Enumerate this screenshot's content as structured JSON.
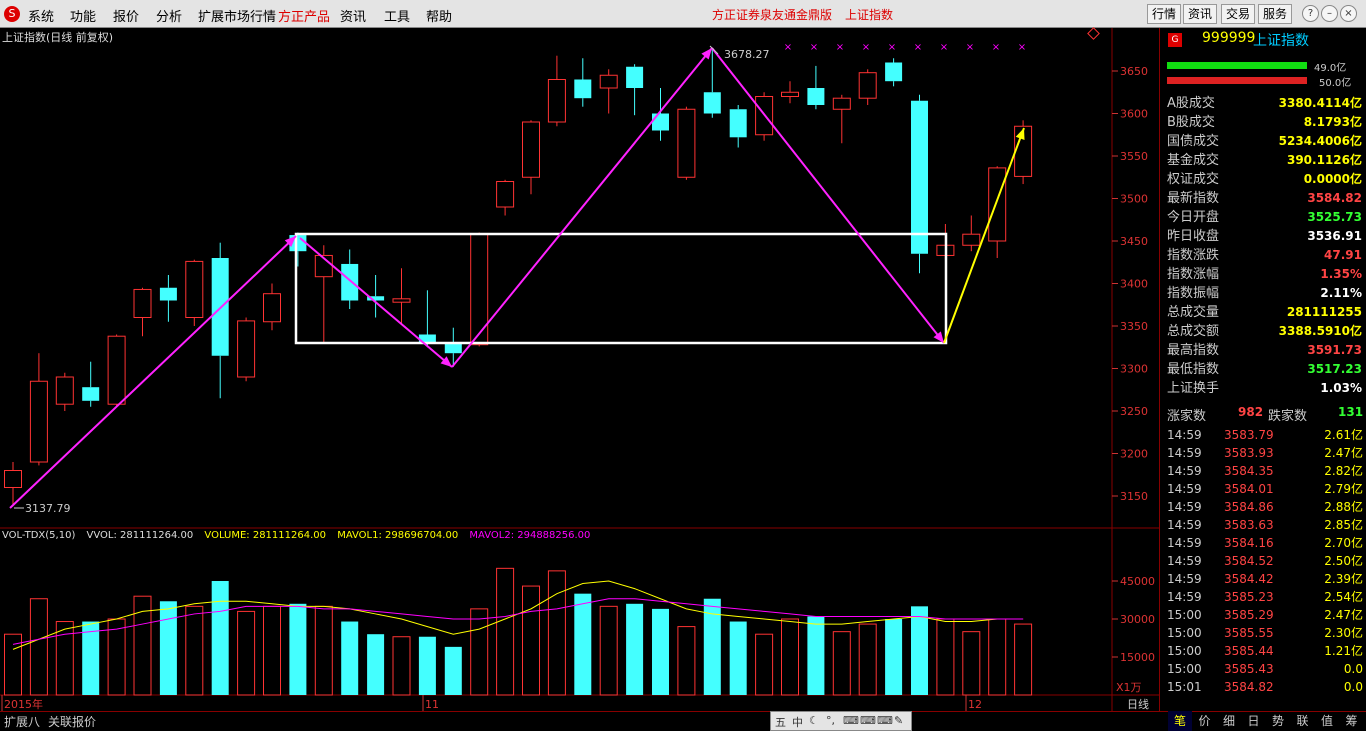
{
  "menu": {
    "items": [
      "系统",
      "功能",
      "报价",
      "分析",
      "扩展市场行情",
      "方正产品",
      "资讯",
      "工具",
      "帮助"
    ],
    "title": "方正证券泉友通金鼎版",
    "title2": "上证指数",
    "right_buttons": [
      "行情",
      "资讯",
      "交易",
      "服务"
    ]
  },
  "chart": {
    "title": "上证指数(日线 前复权)",
    "high_label": "3678.27",
    "low_label": "3137.79",
    "price_ticks": [
      "3650",
      "3600",
      "3550",
      "3500",
      "3450",
      "3400",
      "3350",
      "3300",
      "3250",
      "3200",
      "3150"
    ],
    "vol_ticks": [
      "45000",
      "30000",
      "15000"
    ],
    "vol_unit": "X1万",
    "date_labels": [
      "2015年",
      "11",
      "12"
    ],
    "vol_header": {
      "name": "VOL-TDX(5,10)",
      "vvol": "VVOL: 281111264.00",
      "volume": "VOLUME: 281111264.00",
      "mavol1": "MAVOL1: 298696704.00",
      "mavol2": "MAVOL2: 294888256.00"
    }
  },
  "chart_data": {
    "type": "candlestick",
    "candles": [
      {
        "o": 3160,
        "c": 3180,
        "h": 3190,
        "l": 3138,
        "up": true
      },
      {
        "o": 3190,
        "c": 3285,
        "h": 3318,
        "l": 3186,
        "up": true
      },
      {
        "o": 3258,
        "c": 3290,
        "h": 3295,
        "l": 3250,
        "up": true
      },
      {
        "o": 3278,
        "c": 3262,
        "h": 3308,
        "l": 3255,
        "up": false
      },
      {
        "o": 3258,
        "c": 3338,
        "h": 3340,
        "l": 3255,
        "up": true
      },
      {
        "o": 3360,
        "c": 3393,
        "h": 3395,
        "l": 3338,
        "up": true
      },
      {
        "o": 3395,
        "c": 3380,
        "h": 3410,
        "l": 3355,
        "up": false
      },
      {
        "o": 3360,
        "c": 3426,
        "h": 3428,
        "l": 3350,
        "up": true
      },
      {
        "o": 3430,
        "c": 3315,
        "h": 3448,
        "l": 3265,
        "up": false
      },
      {
        "o": 3290,
        "c": 3356,
        "h": 3360,
        "l": 3285,
        "up": true
      },
      {
        "o": 3355,
        "c": 3388,
        "h": 3400,
        "l": 3345,
        "up": true
      },
      {
        "o": 3457,
        "c": 3438,
        "h": 3460,
        "l": 3420,
        "up": false
      },
      {
        "o": 3408,
        "c": 3433,
        "h": 3445,
        "l": 3330,
        "up": true
      },
      {
        "o": 3423,
        "c": 3380,
        "h": 3440,
        "l": 3370,
        "up": false
      },
      {
        "o": 3385,
        "c": 3380,
        "h": 3410,
        "l": 3360,
        "up": false
      },
      {
        "o": 3378,
        "c": 3382,
        "h": 3418,
        "l": 3352,
        "up": true
      },
      {
        "o": 3340,
        "c": 3330,
        "h": 3392,
        "l": 3325,
        "up": false
      },
      {
        "o": 3330,
        "c": 3318,
        "h": 3348,
        "l": 3302,
        "up": false
      },
      {
        "o": 3328,
        "c": 3458,
        "h": 3460,
        "l": 3326,
        "up": true
      },
      {
        "o": 3490,
        "c": 3520,
        "h": 3522,
        "l": 3480,
        "up": true
      },
      {
        "o": 3525,
        "c": 3590,
        "h": 3592,
        "l": 3505,
        "up": true
      },
      {
        "o": 3590,
        "c": 3640,
        "h": 3668,
        "l": 3585,
        "up": true
      },
      {
        "o": 3640,
        "c": 3618,
        "h": 3665,
        "l": 3608,
        "up": false
      },
      {
        "o": 3630,
        "c": 3645,
        "h": 3652,
        "l": 3600,
        "up": true
      },
      {
        "o": 3655,
        "c": 3630,
        "h": 3658,
        "l": 3598,
        "up": false
      },
      {
        "o": 3600,
        "c": 3580,
        "h": 3630,
        "l": 3568,
        "up": false
      },
      {
        "o": 3525,
        "c": 3605,
        "h": 3608,
        "l": 3522,
        "up": true
      },
      {
        "o": 3625,
        "c": 3600,
        "h": 3675,
        "l": 3595,
        "up": false
      },
      {
        "o": 3605,
        "c": 3572,
        "h": 3610,
        "l": 3560,
        "up": false
      },
      {
        "o": 3575,
        "c": 3620,
        "h": 3625,
        "l": 3568,
        "up": true
      },
      {
        "o": 3620,
        "c": 3625,
        "h": 3638,
        "l": 3612,
        "up": true
      },
      {
        "o": 3630,
        "c": 3610,
        "h": 3656,
        "l": 3605,
        "up": false
      },
      {
        "o": 3605,
        "c": 3618,
        "h": 3622,
        "l": 3565,
        "up": true
      },
      {
        "o": 3618,
        "c": 3648,
        "h": 3652,
        "l": 3610,
        "up": true
      },
      {
        "o": 3660,
        "c": 3638,
        "h": 3665,
        "l": 3632,
        "up": false
      },
      {
        "o": 3615,
        "c": 3435,
        "h": 3622,
        "l": 3412,
        "up": false
      },
      {
        "o": 3445,
        "c": 3433,
        "h": 3470,
        "l": 3428,
        "up": true
      },
      {
        "o": 3445,
        "c": 3458,
        "h": 3480,
        "l": 3438,
        "up": true
      },
      {
        "o": 3450,
        "c": 3536,
        "h": 3538,
        "l": 3430,
        "up": true
      },
      {
        "o": 3526,
        "c": 3585,
        "h": 3592,
        "l": 3517,
        "up": true
      }
    ],
    "volumes": [
      24000,
      38000,
      29000,
      29000,
      30000,
      39000,
      37000,
      35000,
      45000,
      33000,
      35000,
      36000,
      35000,
      29000,
      24000,
      23000,
      23000,
      19000,
      34000,
      50000,
      43000,
      49000,
      40000,
      35000,
      36000,
      34000,
      27000,
      38000,
      29000,
      24000,
      30000,
      31000,
      25000,
      28000,
      30000,
      35000,
      30000,
      25000,
      30000,
      28000
    ],
    "mavol1": [
      18000,
      22000,
      26000,
      28000,
      30000,
      33000,
      34000,
      36000,
      37000,
      37000,
      36000,
      35000,
      35000,
      34000,
      32000,
      30000,
      27000,
      24000,
      26000,
      30000,
      34000,
      40000,
      44000,
      45000,
      42000,
      38000,
      34000,
      32000,
      31000,
      30000,
      29000,
      28000,
      28000,
      29000,
      30000,
      31000,
      29000,
      29000,
      30000,
      30000
    ],
    "mavol2": [
      20000,
      22000,
      24000,
      25000,
      26000,
      28000,
      30000,
      32000,
      33000,
      35000,
      35000,
      35000,
      34000,
      34000,
      33000,
      32000,
      31000,
      30000,
      30000,
      31000,
      33000,
      34000,
      36000,
      38000,
      38000,
      37000,
      36000,
      35000,
      34000,
      33000,
      32000,
      31000,
      31000,
      31000,
      31000,
      31000,
      30000,
      30000,
      30000,
      30000
    ],
    "price_range": [
      3110,
      3720
    ],
    "vol_range": [
      0,
      60000
    ]
  },
  "panel": {
    "code": "999999",
    "name": "上证指数",
    "buy_amount": "49.0亿",
    "sell_amount": "50.0亿",
    "rows": [
      {
        "label": "A股成交",
        "value": "3380.4114亿",
        "color": "#ff0"
      },
      {
        "label": "B股成交",
        "value": "8.1793亿",
        "color": "#ff0"
      },
      {
        "label": "国债成交",
        "value": "5234.4006亿",
        "color": "#ff0"
      },
      {
        "label": "基金成交",
        "value": "390.1126亿",
        "color": "#ff0"
      },
      {
        "label": "权证成交",
        "value": "0.0000亿",
        "color": "#ff0"
      },
      {
        "label": "最新指数",
        "value": "3584.82",
        "color": "#f44"
      },
      {
        "label": "今日开盘",
        "value": "3525.73",
        "color": "#3f3"
      },
      {
        "label": "昨日收盘",
        "value": "3536.91",
        "color": "#fff"
      },
      {
        "label": "指数涨跌",
        "value": "47.91",
        "color": "#f44"
      },
      {
        "label": "指数涨幅",
        "value": "1.35%",
        "color": "#f44"
      },
      {
        "label": "指数振幅",
        "value": "2.11%",
        "color": "#fff"
      },
      {
        "label": "总成交量",
        "value": "281111255",
        "color": "#ff0"
      },
      {
        "label": "总成交额",
        "value": "3388.5910亿",
        "color": "#ff0"
      },
      {
        "label": "最高指数",
        "value": "3591.73",
        "color": "#f44"
      },
      {
        "label": "最低指数",
        "value": "3517.23",
        "color": "#3f3"
      },
      {
        "label": "上证换手",
        "value": "1.03%",
        "color": "#fff"
      }
    ],
    "up_label": "涨家数",
    "up_count": "982",
    "down_label": "跌家数",
    "down_count": "131",
    "trades": [
      {
        "t": "14:59",
        "p": "3583.79",
        "v": "2.61亿"
      },
      {
        "t": "14:59",
        "p": "3583.93",
        "v": "2.47亿"
      },
      {
        "t": "14:59",
        "p": "3584.35",
        "v": "2.82亿"
      },
      {
        "t": "14:59",
        "p": "3584.01",
        "v": "2.79亿"
      },
      {
        "t": "14:59",
        "p": "3584.86",
        "v": "2.88亿"
      },
      {
        "t": "14:59",
        "p": "3583.63",
        "v": "2.85亿"
      },
      {
        "t": "14:59",
        "p": "3584.16",
        "v": "2.70亿"
      },
      {
        "t": "14:59",
        "p": "3584.52",
        "v": "2.50亿"
      },
      {
        "t": "14:59",
        "p": "3584.42",
        "v": "2.39亿"
      },
      {
        "t": "14:59",
        "p": "3585.23",
        "v": "2.54亿"
      },
      {
        "t": "15:00",
        "p": "3585.29",
        "v": "2.47亿"
      },
      {
        "t": "15:00",
        "p": "3585.55",
        "v": "2.30亿"
      },
      {
        "t": "15:00",
        "p": "3585.44",
        "v": "1.21亿"
      },
      {
        "t": "15:00",
        "p": "3585.43",
        "v": "0.0"
      },
      {
        "t": "15:01",
        "p": "3584.82",
        "v": "0.0"
      }
    ]
  },
  "bottom": {
    "left_tabs": [
      "扩展八",
      "关联报价"
    ],
    "center_tools": [
      "五",
      "中",
      "☾",
      "°,",
      "⌨",
      "⌨",
      "⌨",
      "✎"
    ],
    "right_label": "日线",
    "right_tabs": [
      "笔",
      "价",
      "细",
      "日",
      "势",
      "联",
      "值",
      "筹"
    ]
  }
}
